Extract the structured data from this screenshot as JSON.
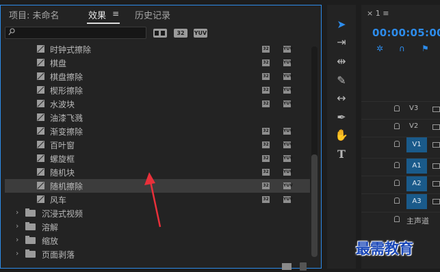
{
  "tabs": {
    "project": "项目: 未命名",
    "effects": "效果",
    "menu_icon": "≡",
    "history": "历史记录"
  },
  "search": {
    "placeholder": ""
  },
  "toolbar": {
    "accel_label": "",
    "b32_label": "32",
    "yuv_label": "YUV"
  },
  "badges": {
    "b32": "32",
    "yuv": "YUV"
  },
  "effects_list": [
    {
      "label": "时钟式擦除",
      "partial": true,
      "badges": true
    },
    {
      "label": "棋盘",
      "badges": true
    },
    {
      "label": "棋盘擦除",
      "badges": true
    },
    {
      "label": "楔形擦除",
      "badges": true
    },
    {
      "label": "水波块",
      "badges": true
    },
    {
      "label": "油漆飞溅",
      "badges": false
    },
    {
      "label": "渐变擦除",
      "badges": true
    },
    {
      "label": "百叶窗",
      "badges": true
    },
    {
      "label": "螺旋框",
      "badges": true
    },
    {
      "label": "随机块",
      "badges": true
    },
    {
      "label": "随机擦除",
      "badges": true,
      "selected": true
    },
    {
      "label": "风车",
      "badges": true
    }
  ],
  "folders": [
    "沉浸式视频",
    "溶解",
    "缩放",
    "页面剥落"
  ],
  "timeline": {
    "sequence_tab": "× 1 ≡",
    "timecode": "00:00:05:00",
    "tracks": [
      {
        "name": "V3",
        "type": "video"
      },
      {
        "name": "V2",
        "type": "video"
      },
      {
        "name": "V1",
        "type": "video",
        "source": true
      },
      {
        "name": "A1",
        "type": "audio",
        "source": true
      },
      {
        "name": "A2",
        "type": "audio",
        "source": true
      },
      {
        "name": "A3",
        "type": "audio",
        "source": true
      },
      {
        "name": "主声道",
        "type": "master"
      }
    ]
  },
  "tools": [
    "selection-tool",
    "track-select-tool",
    "ripple-edit-tool",
    "razor-tool",
    "slip-tool",
    "pen-tool",
    "hand-tool",
    "type-tool"
  ],
  "watermark": "最需教育",
  "colors": {
    "accent": "#2d8ceb",
    "selected_row": "#3c3c3c",
    "annotation_arrow": "#e8303a",
    "watermark": "#1b48b8"
  }
}
